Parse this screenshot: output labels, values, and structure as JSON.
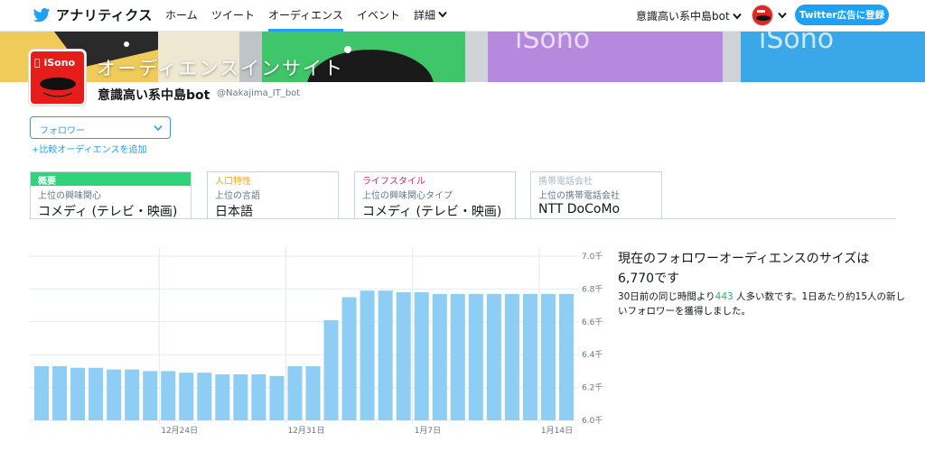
{
  "nav": {
    "brand": "アナリティクス",
    "items": [
      "ホーム",
      "ツイート",
      "オーディエンス",
      "イベント",
      "詳細"
    ],
    "account": "意識高い系中島bot",
    "ads_button": "Twitter広告に登録"
  },
  "header": {
    "title": "オーディエンスインサイト",
    "profile_logo": " iSono",
    "user_name": "意識高い系中島bot",
    "handle": "@Nakajima_IT_bot"
  },
  "audience_select": {
    "value": "フォロワー",
    "add_link": "+比較オーディエンスを追加"
  },
  "categories": [
    {
      "head": "概要",
      "sub": "上位の興味関心",
      "value": "コメディ (テレビ・映画)",
      "color": "#ffffff",
      "bg": "#2fd37a"
    },
    {
      "head": "人口特性",
      "sub": "上位の言語",
      "value": "日本語",
      "color": "#f5a623",
      "bg": "#ffffff"
    },
    {
      "head": "ライフスタイル",
      "sub": "上位の興味関心タイプ",
      "value": "コメディ (テレビ・映画)",
      "color": "#e0245e",
      "bg": "#ffffff"
    },
    {
      "head": "携帯電話会社",
      "sub": "上位の携帯電話会社",
      "value": "NTT DoCoMo",
      "color": "#aab8c2",
      "bg": "#ffffff"
    }
  ],
  "summary": {
    "title_line1": "現在のフォロワーオーディエンスのサイズは",
    "title_line2": "6,770です",
    "text_pre": "30日前の同じ時間より",
    "delta": "443",
    "text_post": " 人多い数です。1日あたり約15人の新しいフォロワーを獲得しました。"
  },
  "chart_data": {
    "type": "bar",
    "color": "#8ecdf4",
    "ylim": [
      6.0,
      7.0
    ],
    "yticks": [
      "6.0千",
      "6.2千",
      "6.4千",
      "6.6千",
      "6.8千",
      "7.0千"
    ],
    "xticks": [
      {
        "label": "12月24日",
        "index": 6.5
      },
      {
        "label": "12月31日",
        "index": 13.5
      },
      {
        "label": "1月7日",
        "index": 20.5
      },
      {
        "label": "1月14日",
        "index": 27.5
      }
    ],
    "values": [
      6.33,
      6.33,
      6.32,
      6.32,
      6.31,
      6.31,
      6.3,
      6.3,
      6.29,
      6.29,
      6.28,
      6.28,
      6.28,
      6.27,
      6.33,
      6.33,
      6.61,
      6.75,
      6.79,
      6.79,
      6.78,
      6.78,
      6.77,
      6.77,
      6.77,
      6.77,
      6.77,
      6.77,
      6.77,
      6.77
    ]
  }
}
